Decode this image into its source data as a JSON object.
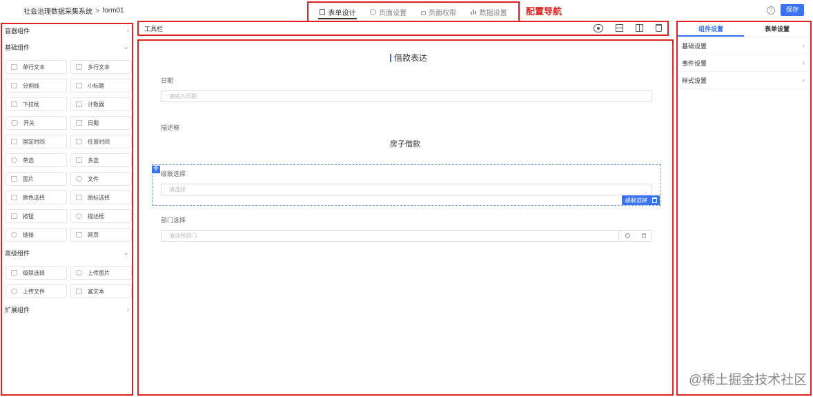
{
  "header": {
    "app_name": "社会治理数据采集系统",
    "separator": ">",
    "form_name": "form01",
    "tabs": [
      {
        "label": "表单设计",
        "icon": "document-icon",
        "active": true
      },
      {
        "label": "页面设置",
        "icon": "gear-icon",
        "active": false
      },
      {
        "label": "页面权限",
        "icon": "lock-icon",
        "active": false
      },
      {
        "label": "数据设置",
        "icon": "bar-chart-icon",
        "active": false
      }
    ],
    "nav_annotation": "配置导航",
    "help_glyph": "?",
    "save_label": "保存",
    "accent_color": "#3a74f5",
    "annotation_color": "#e02020"
  },
  "left_panel": {
    "container_group": {
      "label": "容器组件",
      "chevron": "›"
    },
    "basic_group": {
      "label": "基础组件",
      "chevron": "⌄",
      "items": [
        {
          "label": "单行文本",
          "icon": "single-line-text-icon"
        },
        {
          "label": "多行文本",
          "icon": "multi-line-text-icon"
        },
        {
          "label": "分割线",
          "icon": "divider-icon"
        },
        {
          "label": "小标题",
          "icon": "subtitle-icon"
        },
        {
          "label": "下拉框",
          "icon": "dropdown-icon"
        },
        {
          "label": "计数器",
          "icon": "counter-icon"
        },
        {
          "label": "开关",
          "icon": "toggle-icon"
        },
        {
          "label": "日期",
          "icon": "calendar-icon"
        },
        {
          "label": "固定时间",
          "icon": "fixed-time-icon"
        },
        {
          "label": "任意时间",
          "icon": "any-time-icon"
        },
        {
          "label": "单选",
          "icon": "radio-icon"
        },
        {
          "label": "多选",
          "icon": "checkbox-icon"
        },
        {
          "label": "图片",
          "icon": "image-icon"
        },
        {
          "label": "文件",
          "icon": "paperclip-icon"
        },
        {
          "label": "颜色选择",
          "icon": "color-picker-icon"
        },
        {
          "label": "图标选择",
          "icon": "icon-picker-icon"
        },
        {
          "label": "按钮",
          "icon": "button-icon"
        },
        {
          "label": "描述框",
          "icon": "description-icon"
        },
        {
          "label": "链接",
          "icon": "link-icon"
        },
        {
          "label": "网页",
          "icon": "webpage-icon"
        }
      ]
    },
    "advanced_group": {
      "label": "高级组件",
      "chevron": "⌄",
      "items": [
        {
          "label": "级联选择",
          "icon": "cascader-icon"
        },
        {
          "label": "上传图片",
          "icon": "upload-image-icon"
        },
        {
          "label": "上传文件",
          "icon": "upload-file-icon"
        },
        {
          "label": "富文本",
          "icon": "rich-text-icon"
        }
      ]
    },
    "extension_group": {
      "label": "扩展组件",
      "chevron": "›"
    }
  },
  "toolbar": {
    "label": "工具栏",
    "icons": [
      "eye-icon",
      "split-horizontal-icon",
      "split-vertical-icon",
      "trash-icon"
    ]
  },
  "canvas": {
    "title": "借款表达",
    "date_field": {
      "label": "日期",
      "placeholder": "请输入日期"
    },
    "description_field": {
      "label": "描述框",
      "text": "房子借款"
    },
    "cascader_field": {
      "label": "级联选择",
      "placeholder": "请选择",
      "selected_tag": "级联选择",
      "chevron": "⌄",
      "move_glyph": "✛"
    },
    "department_field": {
      "label": "部门选择",
      "placeholder": "请选择部门"
    }
  },
  "right_panel": {
    "tabs": [
      {
        "label": "组件设置",
        "active": true
      },
      {
        "label": "表单设置",
        "active": false
      }
    ],
    "rows": [
      {
        "label": "基础设置",
        "chevron": "›"
      },
      {
        "label": "事件设置",
        "chevron": "›"
      },
      {
        "label": "样式设置",
        "chevron": "›"
      }
    ]
  },
  "watermark": "@稀土掘金技术社区"
}
